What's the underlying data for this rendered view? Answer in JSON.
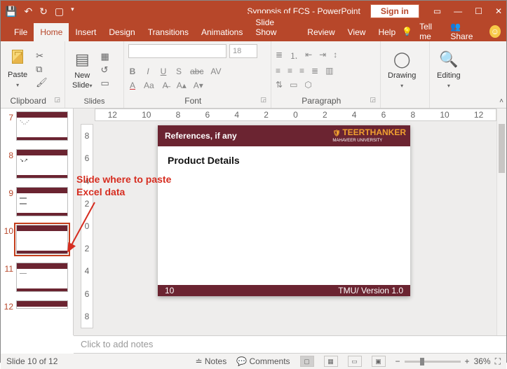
{
  "title": {
    "doc": "Synopsis of FCS",
    "app": "PowerPoint",
    "sep": " - ",
    "signin": "Sign in"
  },
  "tabs": {
    "file": "File",
    "home": "Home",
    "insert": "Insert",
    "design": "Design",
    "transitions": "Transitions",
    "animations": "Animations",
    "slideshow": "Slide Show",
    "review": "Review",
    "view": "View",
    "help": "Help",
    "tellme": "Tell me",
    "share": "Share"
  },
  "ribbon": {
    "clipboard": {
      "label": "Clipboard",
      "paste": "Paste"
    },
    "slides": {
      "label": "Slides",
      "new": "New\nSlide"
    },
    "font": {
      "label": "Font",
      "size": "18"
    },
    "paragraph": {
      "label": "Paragraph"
    },
    "drawing": {
      "label": "Drawing"
    },
    "editing": {
      "label": "Editing"
    }
  },
  "thumbs": [
    {
      "n": "7"
    },
    {
      "n": "8"
    },
    {
      "n": "9"
    },
    {
      "n": "10",
      "selected": true
    },
    {
      "n": "11"
    },
    {
      "n": "12"
    }
  ],
  "ruler_h": [
    "12",
    "10",
    "8",
    "6",
    "4",
    "2",
    "0",
    "2",
    "4",
    "6",
    "8",
    "10",
    "12"
  ],
  "ruler_v": [
    "8",
    "6",
    "4",
    "2",
    "0",
    "2",
    "4",
    "6",
    "8"
  ],
  "annotation": "Slide where to paste Excel data",
  "slide": {
    "header": "References, if any",
    "logo_top": "TEERTHANKER",
    "logo_sub": "MAHAVEER UNIVERSITY",
    "body": "Product Details",
    "footer_left": "10",
    "footer_right": "TMU/ Version 1.0"
  },
  "notes_placeholder": "Click to add notes",
  "status": {
    "slide": "Slide 10 of 12",
    "notes": "Notes",
    "comments": "Comments",
    "zoom": "36%"
  }
}
